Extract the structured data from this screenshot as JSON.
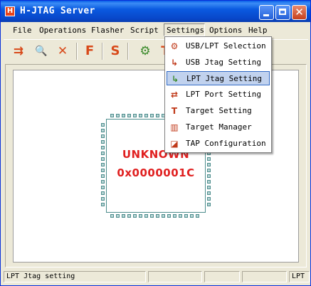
{
  "window": {
    "title": "H-JTAG Server",
    "app_icon": "H"
  },
  "title_buttons": {
    "close_glyph": "✕"
  },
  "menubar": {
    "items": [
      {
        "label": "File"
      },
      {
        "label": "Operations"
      },
      {
        "label": "Flasher"
      },
      {
        "label": "Script"
      },
      {
        "label": "Settings"
      },
      {
        "label": "Options"
      },
      {
        "label": "Help"
      }
    ]
  },
  "toolbar": {
    "icons": [
      "detect-target-icon",
      "search-icon",
      "disconnect-x-icon",
      "flasher-icon",
      "script-icon",
      "settings-icon",
      "target-icon"
    ],
    "glyphs": [
      "⇉",
      "🔍",
      "✕",
      "F",
      "S",
      "⚙",
      "T"
    ]
  },
  "chip": {
    "status": "UNKNOWN",
    "id": "0x0000001C",
    "text_color": "#e02020"
  },
  "settings_menu": {
    "items": [
      {
        "label": "USB/LPT Selection",
        "icon": "usb-lpt-selection-icon",
        "glyph": "⚙",
        "color": "#c03a1a"
      },
      {
        "label": "USB Jtag Setting",
        "icon": "usb-jtag-icon",
        "glyph": "↳",
        "color": "#c03a1a"
      },
      {
        "label": "LPT Jtag Setting",
        "icon": "lpt-jtag-icon",
        "glyph": "↳",
        "color": "#3a8a2a"
      },
      {
        "label": "LPT Port Setting",
        "icon": "lpt-port-icon",
        "glyph": "⇄",
        "color": "#c03a1a"
      },
      {
        "label": "Target Setting",
        "icon": "target-setting-icon",
        "glyph": "T",
        "color": "#c03a1a"
      },
      {
        "label": "Target Manager",
        "icon": "target-manager-icon",
        "glyph": "▥",
        "color": "#c03a1a"
      },
      {
        "label": "TAP Configuration",
        "icon": "tap-configuration-icon",
        "glyph": "◪",
        "color": "#c03a1a"
      }
    ],
    "highlighted_index": 2
  },
  "statusbar": {
    "message": "LPT Jtag setting",
    "mode": "LPT"
  }
}
